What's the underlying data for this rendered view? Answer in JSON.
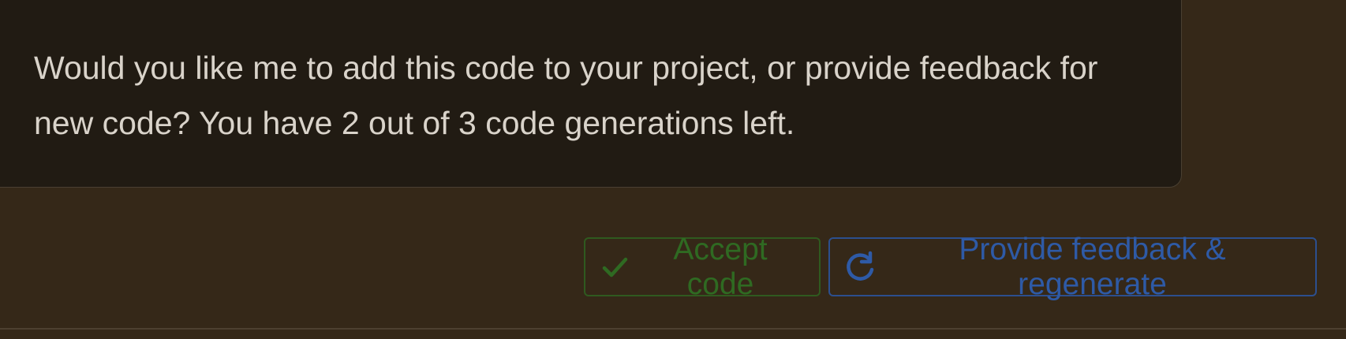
{
  "message": {
    "text": "Would you like me to add this code to your project, or provide feedback for new code? You have 2 out of 3 code generations left."
  },
  "actions": {
    "accept_label": "Accept code",
    "accept_icon": "check-icon",
    "regenerate_label": "Provide feedback & regenerate",
    "regenerate_icon": "refresh-icon"
  },
  "colors": {
    "page_background": "#352818",
    "card_background": "#211b13",
    "message_text": "#d9d3ca",
    "accept_accent": "#2f6a22",
    "regenerate_accent": "#2e5aa6"
  }
}
